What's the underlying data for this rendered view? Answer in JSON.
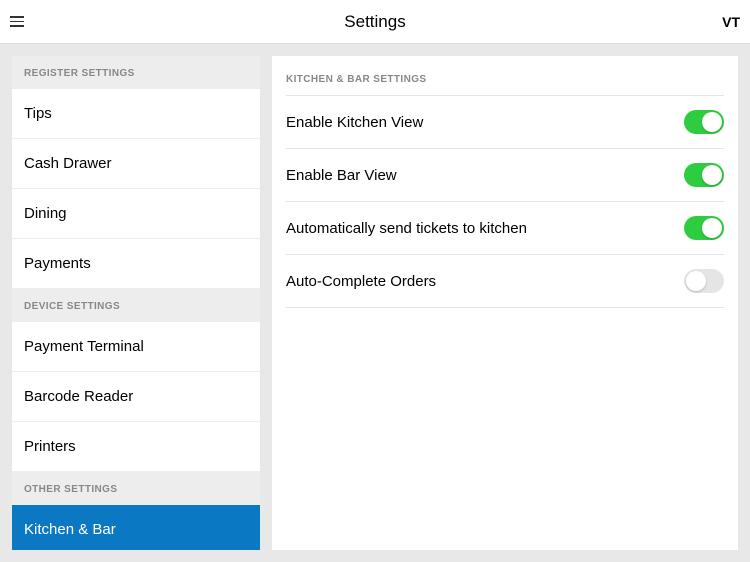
{
  "header": {
    "title": "Settings",
    "userBadge": "VT"
  },
  "sidebar": {
    "sections": [
      {
        "header": "REGISTER SETTINGS",
        "items": [
          {
            "label": "Tips",
            "name": "sidebar-item-tips",
            "selected": false
          },
          {
            "label": "Cash Drawer",
            "name": "sidebar-item-cash-drawer",
            "selected": false
          },
          {
            "label": "Dining",
            "name": "sidebar-item-dining",
            "selected": false
          },
          {
            "label": "Payments",
            "name": "sidebar-item-payments",
            "selected": false
          }
        ]
      },
      {
        "header": "DEVICE SETTINGS",
        "items": [
          {
            "label": "Payment Terminal",
            "name": "sidebar-item-payment-terminal",
            "selected": false
          },
          {
            "label": "Barcode Reader",
            "name": "sidebar-item-barcode-reader",
            "selected": false
          },
          {
            "label": "Printers",
            "name": "sidebar-item-printers",
            "selected": false
          }
        ]
      },
      {
        "header": "OTHER SETTINGS",
        "items": [
          {
            "label": "Kitchen & Bar",
            "name": "sidebar-item-kitchen-bar",
            "selected": true
          }
        ]
      }
    ]
  },
  "main": {
    "sectionHeader": "KITCHEN & BAR SETTINGS",
    "settings": [
      {
        "label": "Enable Kitchen View",
        "name": "toggle-enable-kitchen-view",
        "on": true
      },
      {
        "label": "Enable Bar View",
        "name": "toggle-enable-bar-view",
        "on": true
      },
      {
        "label": "Automatically send tickets to kitchen",
        "name": "toggle-auto-send-tickets",
        "on": true
      },
      {
        "label": "Auto-Complete Orders",
        "name": "toggle-auto-complete-orders",
        "on": false
      }
    ]
  }
}
